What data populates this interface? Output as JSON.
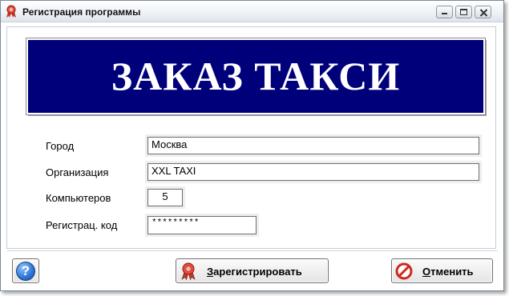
{
  "window": {
    "title": "Регистрация программы"
  },
  "banner": {
    "title": "ЗАКАЗ ТАКСИ"
  },
  "form": {
    "city_label": "Город",
    "city_value": "Москва",
    "org_label": "Организация",
    "org_value": "XXL TAXI",
    "computers_label": "Компьютеров",
    "computers_value": "5",
    "regcode_label": "Регистрац. код",
    "regcode_value": "*********"
  },
  "buttons": {
    "help_glyph": "?",
    "register_hotkey": "З",
    "register_rest": "арегистрировать",
    "cancel_hotkey": "О",
    "cancel_rest": "тменить"
  },
  "icons": {
    "title": "ribbon-award-icon",
    "help": "help-icon",
    "register": "ribbon-award-icon",
    "cancel": "cancel-icon"
  },
  "colors": {
    "banner_bg": "#00007b",
    "banner_text": "#ffffff"
  }
}
